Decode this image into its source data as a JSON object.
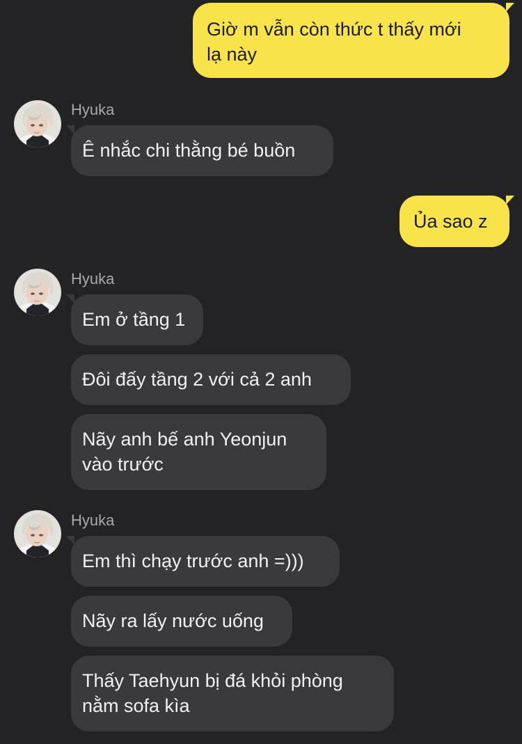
{
  "colors": {
    "background": "#232325",
    "outgoing_bubble": "#f9e34b",
    "incoming_bubble": "#3a3a3c",
    "sender_name": "#a9a9ad"
  },
  "messages": [
    {
      "direction": "out",
      "text": "Giờ m vẫn còn thức t thấy mới\nlạ này"
    },
    {
      "direction": "in",
      "sender": "Hyuka",
      "avatar": "user-avatar-icon",
      "text": "Ê nhắc chi thằng bé buồn"
    },
    {
      "direction": "out",
      "text": "Ủa sao z"
    },
    {
      "direction": "in",
      "sender": "Hyuka",
      "avatar": "user-avatar-icon",
      "text": "Em ở tầng 1"
    },
    {
      "direction": "in",
      "text": "Đôi đấy tầng 2 với cả 2 anh"
    },
    {
      "direction": "in",
      "text": "Nãy anh bế anh Yeonjun\nvào trước"
    },
    {
      "direction": "in",
      "sender": "Hyuka",
      "avatar": "user-avatar-icon",
      "text": "Em thì chạy trước anh =)))"
    },
    {
      "direction": "in",
      "text": "Nãy ra lấy nước uống"
    },
    {
      "direction": "in",
      "text": "Thấy Taehyun bị đá khỏi phòng\nnằm sofa kìa"
    }
  ]
}
